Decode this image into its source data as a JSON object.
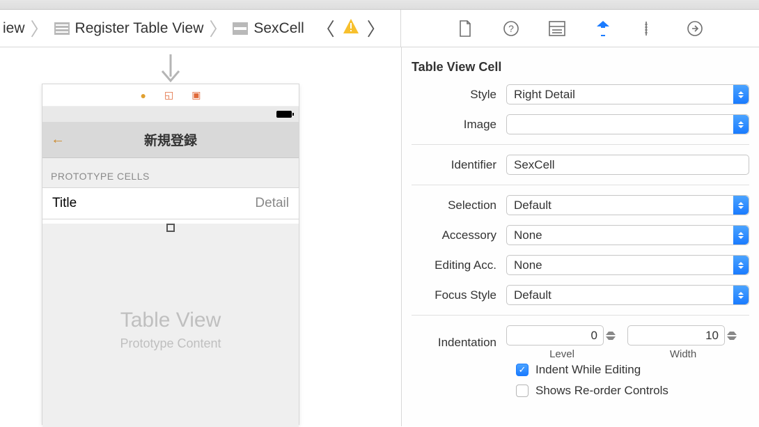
{
  "breadcrumb": {
    "item0_partial": "iew",
    "item1": "Register Table View",
    "item2": "SexCell"
  },
  "phone": {
    "nav_title": "新規登録",
    "section_header": "PROTOTYPE CELLS",
    "cell_title": "Title",
    "cell_detail": "Detail",
    "placeholder_big": "Table View",
    "placeholder_small": "Prototype Content"
  },
  "inspector": {
    "title": "Table View Cell",
    "style": {
      "label": "Style",
      "value": "Right Detail"
    },
    "image": {
      "label": "Image",
      "value": ""
    },
    "identifier": {
      "label": "Identifier",
      "value": "SexCell"
    },
    "selection": {
      "label": "Selection",
      "value": "Default"
    },
    "accessory": {
      "label": "Accessory",
      "value": "None"
    },
    "editing_acc": {
      "label": "Editing Acc.",
      "value": "None"
    },
    "focus_style": {
      "label": "Focus Style",
      "value": "Default"
    },
    "indentation": {
      "label": "Indentation",
      "level": "0",
      "level_label": "Level",
      "width": "10",
      "width_label": "Width"
    },
    "indent_while_editing": "Indent While Editing",
    "shows_reorder": "Shows Re-order Controls"
  }
}
